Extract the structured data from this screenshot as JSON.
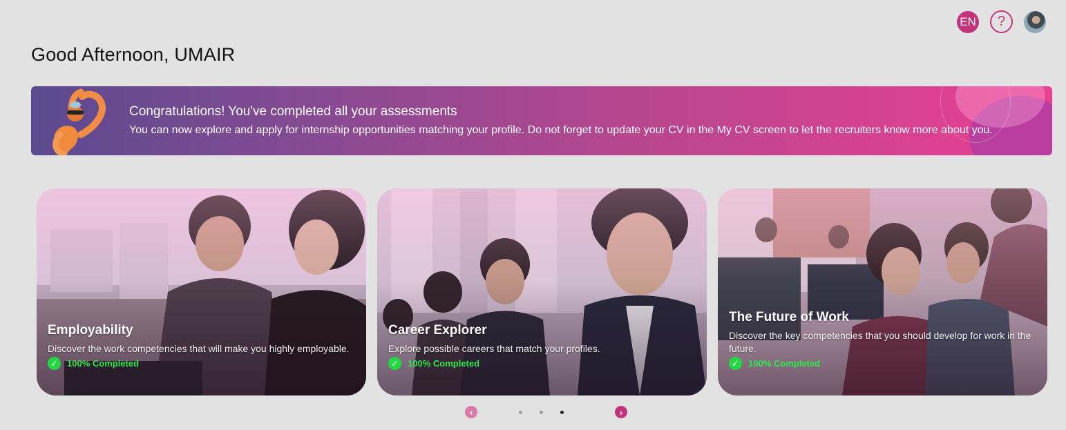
{
  "header": {
    "language_label": "EN",
    "help_label": "?",
    "greeting": "Good Afternoon, UMAIR"
  },
  "banner": {
    "title": "Congratulations! You've completed all your assessments",
    "text": "You can now explore and apply for internship opportunities matching your profile. Do not forget to update your CV in the My CV screen to let the recruiters know more about you."
  },
  "cards": [
    {
      "title": "Employability",
      "description": "Discover the work competencies that will make you highly employable.",
      "status": "100% Completed"
    },
    {
      "title": "Career Explorer",
      "description": "Explore possible careers that match your profiles.",
      "status": "100% Completed"
    },
    {
      "title": "The Future of Work",
      "description": "Discover the key competencies that you should develop for work in the future.",
      "status": "100% Completed"
    }
  ],
  "carousel": {
    "active_dot": 3,
    "dot_count": 3
  },
  "colors": {
    "accent": "#c2337a",
    "completed": "#2ee84c",
    "background": "#e2e2e2"
  },
  "icons": {
    "help": "question-circle-icon",
    "prev": "chevron-left-icon",
    "next": "chevron-right-icon",
    "check": "check-circle-icon"
  }
}
